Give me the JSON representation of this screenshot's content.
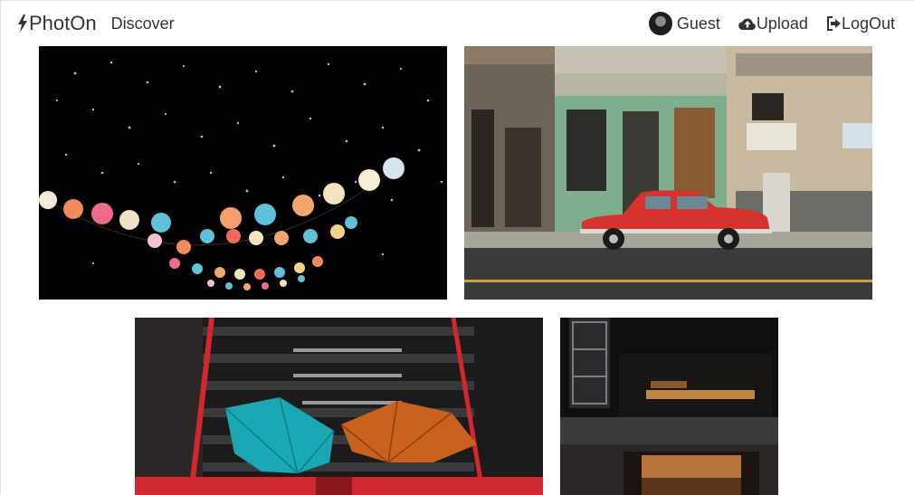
{
  "app": {
    "brand": "PhotOn"
  },
  "nav": {
    "discover": "Discover",
    "user": "Guest",
    "upload": "Upload",
    "logout": "LogOut"
  },
  "icons": [
    "bolt-icon",
    "avatar",
    "cloud-upload-icon",
    "logout-icon"
  ],
  "gallery": [
    {
      "name": "lanterns-photo",
      "colors": [
        "#000000",
        "#f28a5c",
        "#5fc2d8"
      ]
    },
    {
      "name": "red-car-photo",
      "colors": [
        "#d7332e",
        "#7fae8f",
        "#c9b9a0"
      ]
    },
    {
      "name": "umbrellas-photo",
      "colors": [
        "#1aa9b4",
        "#c8621e",
        "#d3262f"
      ]
    },
    {
      "name": "dark-building-photo",
      "colors": [
        "#111111",
        "#c48442",
        "#3a3a3a"
      ]
    }
  ]
}
